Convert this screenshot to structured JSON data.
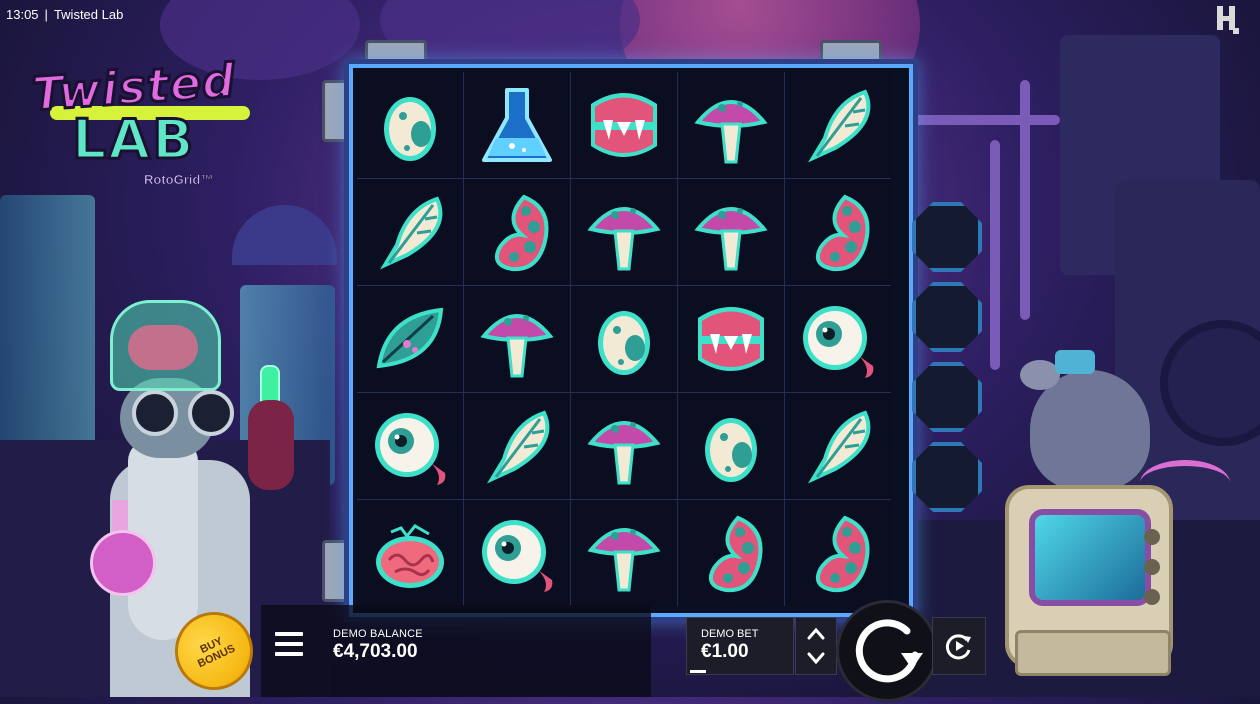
{
  "status_bar": {
    "time": "13:05",
    "separator": "|",
    "title": "Twisted Lab"
  },
  "logo": {
    "line1": "Twisted",
    "line2": "LAB",
    "tagline": "RotoGrid™"
  },
  "reels": {
    "rows": [
      [
        "egg",
        "flask",
        "fangs",
        "mushroom",
        "feather"
      ],
      [
        "feather",
        "tentacle",
        "mushroom",
        "mushroom",
        "tentacle"
      ],
      [
        "leaf",
        "mushroom",
        "egg",
        "fangs",
        "eyeball"
      ],
      [
        "eyeball",
        "feather",
        "mushroom",
        "egg",
        "feather"
      ],
      [
        "brain",
        "eyeball",
        "mushroom",
        "tentacle",
        "tentacle"
      ]
    ]
  },
  "meter": {
    "slots": 4
  },
  "controls": {
    "buy_bonus_line1": "BUY",
    "buy_bonus_line2": "BONUS",
    "balance_label": "DEMO BALANCE",
    "balance_value": "€4,703.00",
    "bet_label": "DEMO BET",
    "bet_value": "€1.00",
    "menu_icon": "hamburger-menu-icon",
    "spin_icon": "refresh-arrow-icon",
    "autoplay_icon": "autoplay-icon"
  },
  "colors": {
    "frame_glow": "#5aa9ff",
    "buy_button": "#f5b812",
    "symbol_outline": "#3de0c8"
  }
}
